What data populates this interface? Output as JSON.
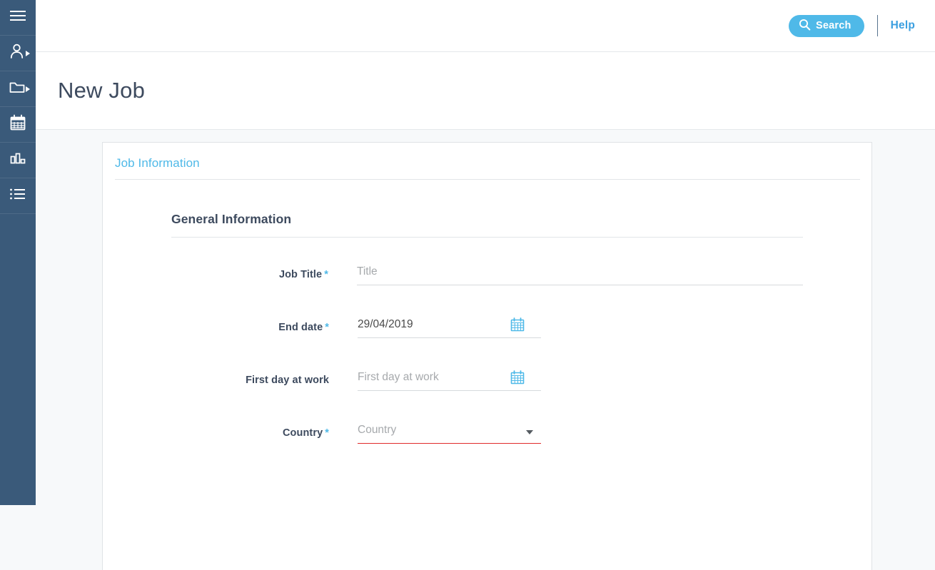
{
  "colors": {
    "sidebar_bg": "#3a5a7a",
    "accent_blue": "#4fb9e8",
    "help_blue": "#3b9fe0",
    "heading_navy": "#3d4a5e",
    "error_red": "#e02b2b",
    "page_bg": "#f7f9fa",
    "field_underline": "#d6dadd"
  },
  "sidebar": {
    "items": [
      {
        "name": "menu-toggle",
        "icon": "hamburger-menu-icon",
        "has_caret": false
      },
      {
        "name": "people",
        "icon": "person-icon",
        "has_caret": true
      },
      {
        "name": "folders",
        "icon": "folder-icon",
        "has_caret": true
      },
      {
        "name": "calendar",
        "icon": "calendar-icon",
        "has_caret": false
      },
      {
        "name": "reports",
        "icon": "bar-chart-icon",
        "has_caret": false
      },
      {
        "name": "lists",
        "icon": "list-icon",
        "has_caret": false
      }
    ]
  },
  "topbar": {
    "search_label": "Search",
    "search_icon": "search-icon",
    "help_label": "Help"
  },
  "header": {
    "page_title": "New Job"
  },
  "card": {
    "tab_label": "Job Information",
    "section_title": "General Information",
    "fields": [
      {
        "id": "job-title",
        "label": "Job Title",
        "required": true,
        "type": "text",
        "value": "",
        "placeholder": "Title",
        "width": "wide",
        "error": false
      },
      {
        "id": "end-date",
        "label": "End date",
        "required": true,
        "type": "date",
        "value": "29/04/2019",
        "placeholder": "End date",
        "width": "short",
        "error": false,
        "icon": "calendar-icon"
      },
      {
        "id": "first-day-at-work",
        "label": "First day at work",
        "required": false,
        "type": "date",
        "value": "",
        "placeholder": "First day at work",
        "width": "short",
        "error": false,
        "icon": "calendar-icon"
      },
      {
        "id": "country",
        "label": "Country",
        "required": true,
        "type": "select",
        "value": "",
        "placeholder": "Country",
        "width": "short",
        "error": true,
        "icon": "chevron-down-icon"
      }
    ]
  }
}
